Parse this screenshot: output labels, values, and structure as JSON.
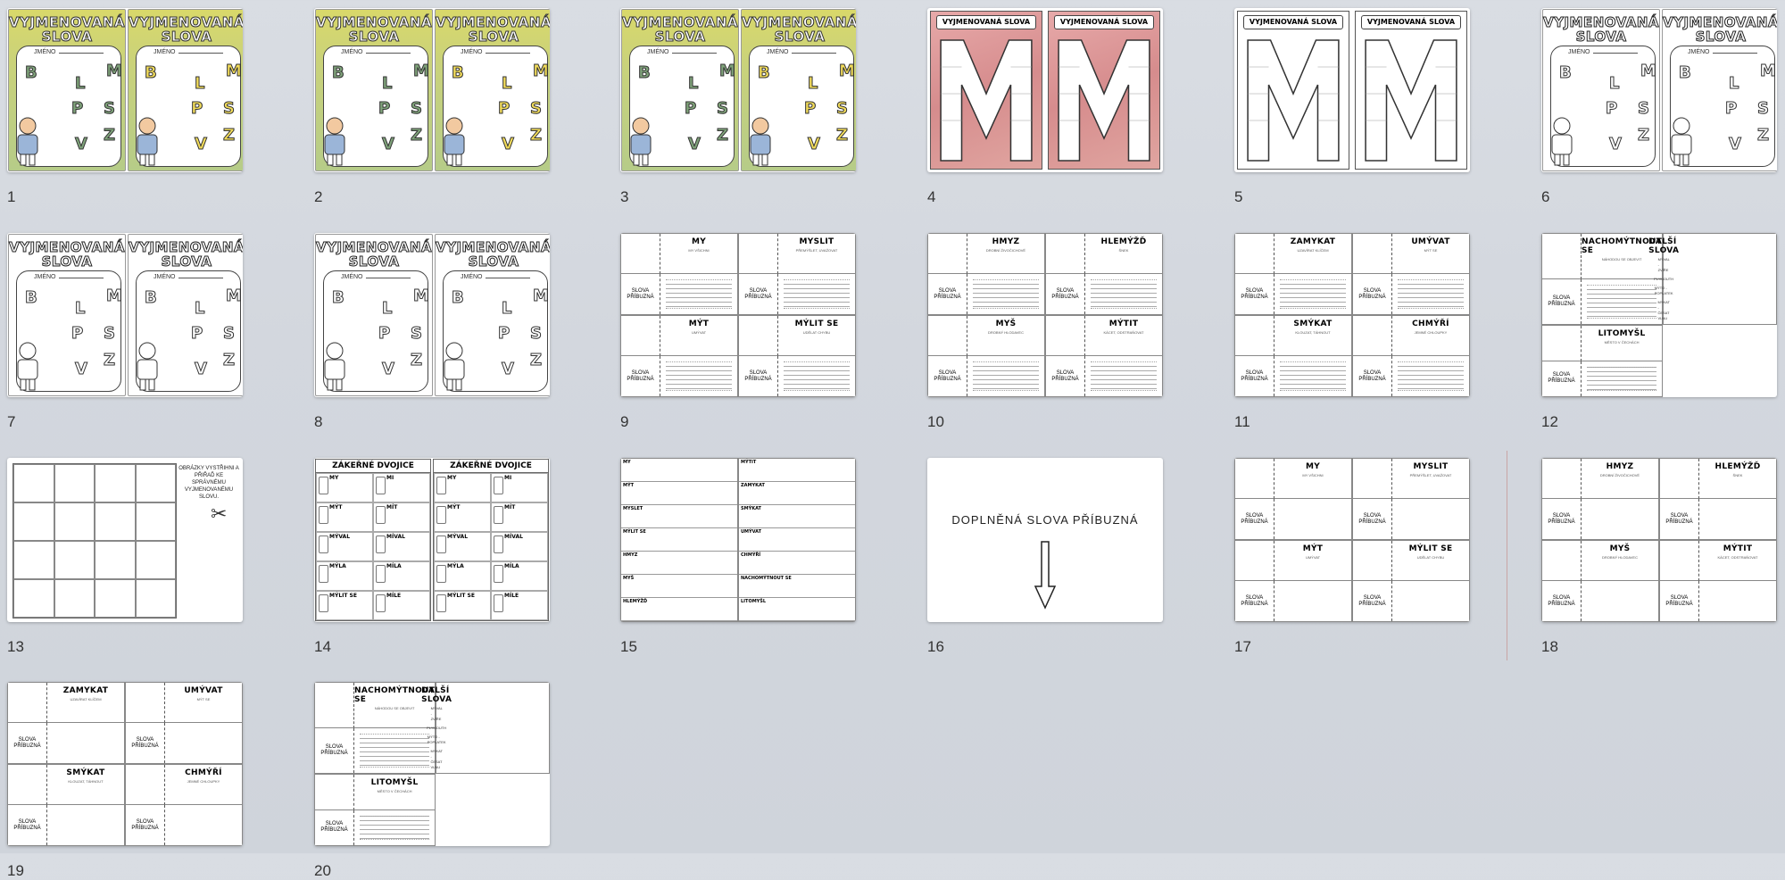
{
  "pages": [
    {
      "number": "1",
      "type": "cover",
      "style": "green",
      "title_l": "VYJMENOVANÁ SLOVA",
      "title_r": "VYJMENOVANÁ SLOVA",
      "name_label": "JMÉNO"
    },
    {
      "number": "2",
      "type": "cover",
      "style": "green",
      "title_l": "VYJMENOVANÁ SLOVA",
      "title_r": "VYJMENOVANÁ SLOVA",
      "name_label": "JMÉNO"
    },
    {
      "number": "3",
      "type": "cover",
      "style": "green",
      "title_l": "VYJMENOVANÁ SLOVA",
      "title_r": "VYJMENOVANÁ SLOVA",
      "name_label": "JMÉNO"
    },
    {
      "number": "4",
      "type": "m",
      "style": "pink",
      "title_l": "VYJMENOVANÁ SLOVA",
      "title_r": "VYJMENOVANÁ SLOVA"
    },
    {
      "number": "5",
      "type": "m",
      "style": "plain",
      "title_l": "VYJMENOVANÁ SLOVA",
      "title_r": "VYJMENOVANÁ SLOVA"
    },
    {
      "number": "6",
      "type": "cover",
      "style": "plain",
      "title_l": "VYJMENOVANÁ SLOVA",
      "title_r": "VYJMENOVANÁ SLOVA",
      "name_label": "JMÉNO"
    },
    {
      "number": "7",
      "type": "cover",
      "style": "plain",
      "title_l": "VYJMENOVANÁ SLOVA",
      "title_r": "VYJMENOVANÁ SLOVA",
      "name_label": "JMÉNO"
    },
    {
      "number": "8",
      "type": "cover",
      "style": "plain",
      "title_l": "VYJMENOVANÁ SLOVA",
      "title_r": "VYJMENOVANÁ SLOVA",
      "name_label": "JMÉNO"
    },
    {
      "number": "9",
      "type": "table",
      "words": [
        "MY",
        "MYSLIT",
        "MÝT",
        "MÝLIT SE"
      ],
      "desc": [
        "MY VŠICHNI",
        "PŘEMÝŠLET, UVAŽOVAT",
        "UMÝVAT",
        "UDĚLAT CHYBU"
      ],
      "label": "SLOVA PŘÍBUZNÁ",
      "fill": false
    },
    {
      "number": "10",
      "type": "table",
      "words": [
        "HMYZ",
        "HLEMÝŽĎ",
        "MYŠ",
        "MÝTIT"
      ],
      "desc": [
        "DROBNÍ ŽIVOČICHOVÉ",
        "ŠNEK",
        "DROBNÝ HLODAVEC",
        "KÁCET, ODSTRAŇOVAT"
      ],
      "label": "SLOVA PŘÍBUZNÁ",
      "fill": false
    },
    {
      "number": "11",
      "type": "table",
      "words": [
        "ZAMYKAT",
        "UMÝVAT",
        "SMÝKAT",
        "CHMÝŘÍ"
      ],
      "desc": [
        "UZAVÍRAT KLÍČEM",
        "MÝT SE",
        "KLOUZAT, TÁHNOUT",
        "JEMNÉ CHLOUPKY"
      ],
      "label": "SLOVA PŘÍBUZNÁ",
      "fill": false
    },
    {
      "number": "12",
      "type": "table12",
      "words": [
        "NACHOMÝTNOUT SE",
        "DALŠÍ SLOVA",
        "LITOMYŠL",
        ""
      ],
      "desc": [
        "NÁHODOU SE OBJEVIT",
        "",
        "MĚSTO V ČECHÁCH",
        ""
      ],
      "label": "SLOVA PŘÍBUZNÁ",
      "extra": [
        "MÝVAL - ZVÍŘE",
        "PLYMOUTH",
        "MÝTO - POPLATEK",
        "MYKAT - ČESAT VLNU"
      ]
    },
    {
      "number": "13",
      "type": "pictures",
      "text": "OBRÁZKY VYSTŘIHNI A PŘIŘAĎ KE SPRÁVNÉMU VYJMENOVANÉMU SLOVU."
    },
    {
      "number": "14",
      "type": "zav",
      "title_l": "ZÁKEŘNÉ DVOJICE",
      "title_r": "ZÁKEŘNÉ DVOJICE",
      "pairs": [
        "MY",
        "MI",
        "MÝT",
        "MÍT",
        "MÝVAL",
        "MÍVAL",
        "MÝLA",
        "MÍLA",
        "MÝLIT SE",
        "MÍLE"
      ]
    },
    {
      "number": "15",
      "type": "list",
      "left": [
        "MY",
        "MÝT",
        "MYSLET",
        "MÝLIT SE",
        "HMYZ",
        "MYŠ",
        "HLEMÝŽĎ"
      ],
      "right": [
        "MÝTIT",
        "ZAMYKAT",
        "SMÝKAT",
        "UMÝVAT",
        "CHMÝŘÍ",
        "NACHOMÝTNOUT SE",
        "LITOMYŠL"
      ]
    },
    {
      "number": "16",
      "type": "text",
      "text": "DOPLNĚNÁ SLOVA PŘÍBUZNÁ"
    },
    {
      "number": "17",
      "type": "table",
      "words": [
        "MY",
        "MYSLIT",
        "MÝT",
        "MÝLIT SE"
      ],
      "desc": [
        "MY VŠICHNI",
        "PŘEMÝŠLET, UVAŽOVAT",
        "UMÝVAT",
        "UDĚLAT CHYBU"
      ],
      "label": "SLOVA PŘÍBUZNÁ",
      "fill": true
    },
    {
      "number": "18",
      "type": "table",
      "words": [
        "HMYZ",
        "HLEMÝŽĎ",
        "MYŠ",
        "MÝTIT"
      ],
      "desc": [
        "DROBNÍ ŽIVOČICHOVÉ",
        "ŠNEK",
        "DROBNÝ HLODAVEC",
        "KÁCET, ODSTRAŇOVAT"
      ],
      "label": "SLOVA PŘÍBUZNÁ",
      "fill": true
    },
    {
      "number": "19",
      "type": "table",
      "words": [
        "ZAMYKAT",
        "UMÝVAT",
        "SMÝKAT",
        "CHMÝŘÍ"
      ],
      "desc": [
        "UZAVÍRAT KLÍČEM",
        "MÝT SE",
        "KLOUZAT, TÁHNOUT",
        "JEMNÉ CHLOUPKY"
      ],
      "label": "SLOVA PŘÍBUZNÁ",
      "fill": true
    },
    {
      "number": "20",
      "type": "table12",
      "words": [
        "NACHOMÝTNOUT SE",
        "DALŠÍ SLOVA",
        "LITOMYŠL",
        ""
      ],
      "desc": [
        "NÁHODOU SE OBJEVIT",
        "",
        "MĚSTO V ČECHÁCH",
        ""
      ],
      "label": "SLOVA PŘÍBUZNÁ",
      "extra": [
        "MÝVAL - ZVÍŘE",
        "PLYMOUTH",
        "MÝTO - POPLATEK",
        "MYKAT - ČESAT VLNU"
      ]
    }
  ],
  "letters": [
    "B",
    "L",
    "M",
    "P",
    "S",
    "V",
    "Z"
  ],
  "colors": {
    "green_cover": "#c9d27b",
    "pink_cover": "#d68c8d",
    "letter_green": "#7fa37a",
    "letter_yellow": "#f2dc5a"
  }
}
